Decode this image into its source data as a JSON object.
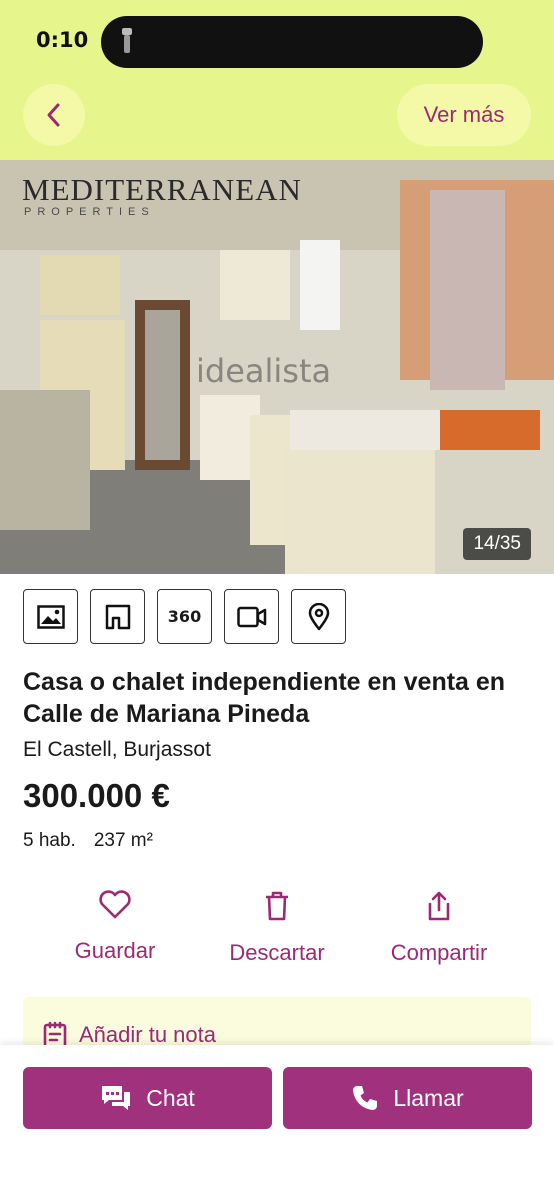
{
  "status_bar": {
    "time": "0:10"
  },
  "header": {
    "back_icon": "chevron-left-icon",
    "more_label": "Ver más"
  },
  "photo": {
    "counter": "14/35",
    "brand": "MEDITERRANEAN",
    "brand_sub": "PROPERTIES",
    "watermark": "idealista"
  },
  "media_buttons": [
    "photo-icon",
    "floorplan-icon",
    "360",
    "video-icon",
    "map-pin-icon"
  ],
  "listing": {
    "title": "Casa o chalet independiente en venta en Calle de Mariana Pineda",
    "location": "El Castell, Burjassot",
    "price": "300.000 €",
    "rooms": "5 hab.",
    "area": "237 m²"
  },
  "actions": {
    "save": "Guardar",
    "discard": "Descartar",
    "share": "Compartir"
  },
  "note": {
    "label": "Añadir tu nota"
  },
  "bottom": {
    "chat": "Chat",
    "call": "Llamar"
  },
  "colors": {
    "header": "#e6f58c",
    "accent": "#9b2a74",
    "button": "#a0317c"
  }
}
